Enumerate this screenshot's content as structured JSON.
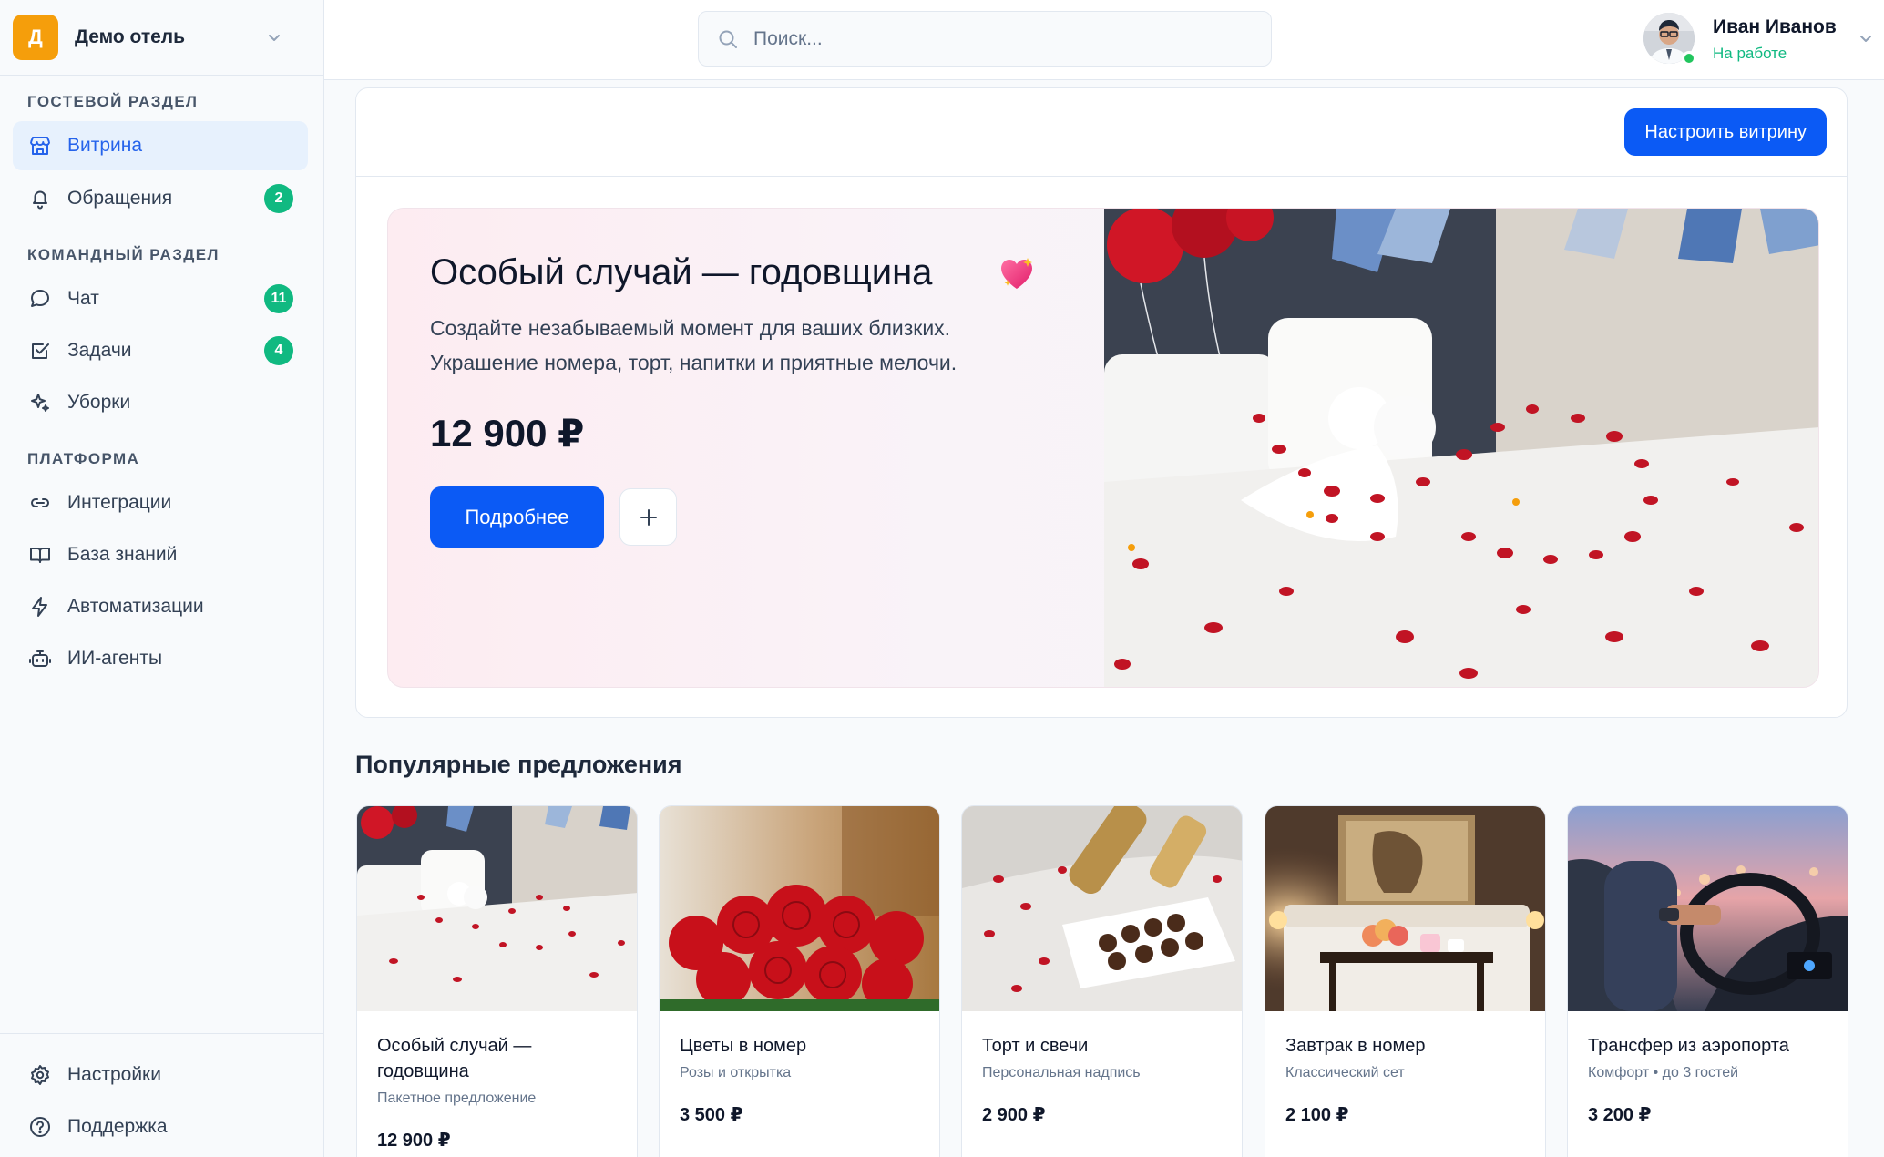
{
  "workspace": {
    "logo_letter": "Д",
    "name": "Демо отель"
  },
  "search": {
    "placeholder": "Поиск..."
  },
  "user": {
    "name": "Иван Иванов",
    "status": "На работе"
  },
  "sidebar": {
    "sections": [
      {
        "title": "ГОСТЕВОЙ РАЗДЕЛ"
      },
      {
        "title": "КОМАНДНЫЙ РАЗДЕЛ"
      },
      {
        "title": "ПЛАТФОРМА"
      }
    ],
    "items": [
      {
        "label": "Витрина",
        "icon": "storefront-icon",
        "active": true
      },
      {
        "label": "Обращения",
        "icon": "bell-icon",
        "badge": "2"
      },
      {
        "label": "Чат",
        "icon": "chat-bubble-icon",
        "badge": "11"
      },
      {
        "label": "Задачи",
        "icon": "checkbox-icon",
        "badge": "4"
      },
      {
        "label": "Уборки",
        "icon": "sparkles-icon"
      },
      {
        "label": "Интеграции",
        "icon": "link-icon"
      },
      {
        "label": "База знаний",
        "icon": "book-icon"
      },
      {
        "label": "Автоматизации",
        "icon": "lightning-icon"
      },
      {
        "label": "ИИ-агенты",
        "icon": "robot-icon"
      }
    ],
    "footer": [
      {
        "label": "Настройки",
        "icon": "gear-icon"
      },
      {
        "label": "Поддержка",
        "icon": "help-circle-icon"
      }
    ]
  },
  "hero": {
    "configure_button": "Настроить витрину",
    "title": "Особый случай — годовщина",
    "emoji": "sparkling-heart-icon",
    "description_line1": "Создайте незабываемый момент для ваших близких.",
    "description_line2": "Украшение номера, торт, напитки и приятные мелочи.",
    "price": "12 900 ₽",
    "more_button": "Подробнее",
    "add_button": "+"
  },
  "popular": {
    "title": "Популярные предложения",
    "offers": [
      {
        "name": "Особый случай — годовщина",
        "subtitle": "Пакетное предложение",
        "price": "12 900 ₽"
      },
      {
        "name": "Цветы в номер",
        "subtitle": "Розы и открытка",
        "price": "3 500 ₽"
      },
      {
        "name": "Торт и свечи",
        "subtitle": "Персональная надпись",
        "price": "2 900 ₽"
      },
      {
        "name": "Завтрак в номер",
        "subtitle": "Классический сет",
        "price": "2 100 ₽"
      },
      {
        "name": "Трансфер из аэропорта",
        "subtitle": "Комфорт • до 3 гостей",
        "price": "3 200 ₽"
      }
    ]
  },
  "colors": {
    "accent": "#0b5af5",
    "badge": "#10b981",
    "active_bg": "#e7f1fd",
    "logo": "#f59e0b"
  }
}
